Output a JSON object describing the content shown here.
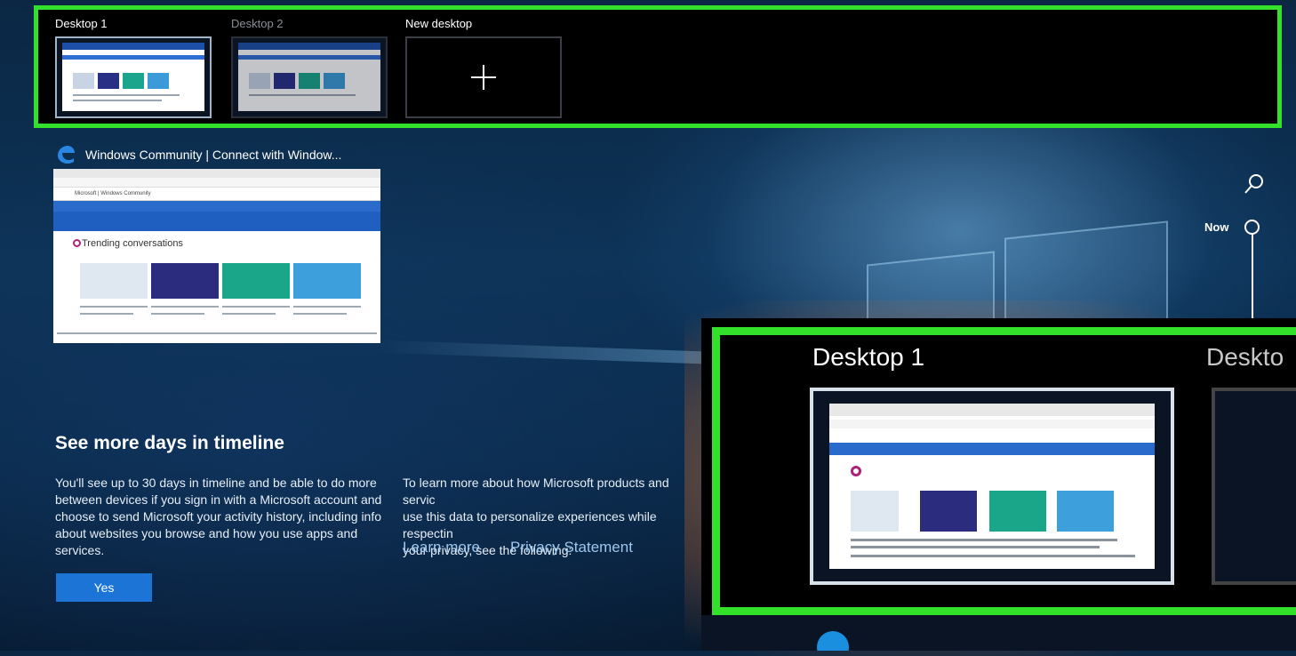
{
  "task_view": {
    "desktops": [
      {
        "label": "Desktop 1",
        "active": true
      },
      {
        "label": "Desktop 2",
        "active": false
      }
    ],
    "new_desktop_label": "New desktop"
  },
  "timeline": {
    "activity": {
      "app_icon": "edge-icon",
      "title": "Windows Community | Connect with Window...",
      "preview": {
        "nav_text": "Microsoft | Windows Community",
        "heading": "Trending conversations"
      }
    },
    "now_label": "Now"
  },
  "promo": {
    "title": "See more days in timeline",
    "body": "You'll see up to 30 days in timeline and be able to do more between devices if you sign in with a Microsoft account and choose to send Microsoft your activity history, including info about websites you browse and how you use apps and services.",
    "learn_text": "To learn more about how Microsoft products and servic\nuse this data to personalize experiences while respectin\nyour privacy, see the following:",
    "learn_more_label": "Learn more",
    "privacy_label": "Privacy Statement",
    "yes_label": "Yes"
  },
  "inset": {
    "desktop1_label": "Desktop 1",
    "desktop2_label": "Deskto"
  },
  "colors": {
    "highlight_green": "#33e02a",
    "accent_blue": "#1b74d6",
    "link_blue": "#9cc7ee"
  }
}
